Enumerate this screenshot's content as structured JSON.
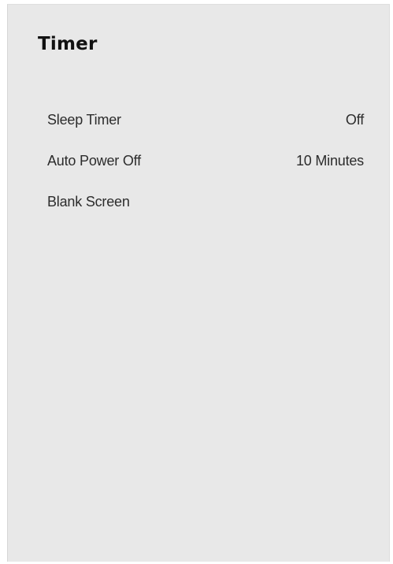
{
  "panel": {
    "title": "Timer"
  },
  "menu": {
    "items": [
      {
        "label": "Sleep Timer",
        "value": "Off"
      },
      {
        "label": "Auto Power Off",
        "value": "10 Minutes"
      },
      {
        "label": "Blank Screen",
        "value": ""
      }
    ]
  }
}
